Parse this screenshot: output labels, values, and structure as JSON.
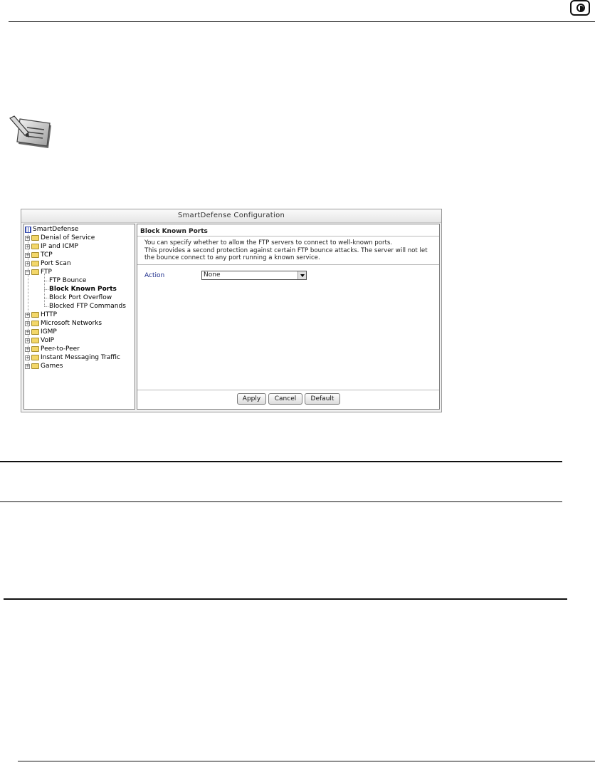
{
  "dialog": {
    "title": "SmartDefense Configuration",
    "tree": {
      "root": "SmartDefense",
      "items": [
        {
          "label": "Denial of Service"
        },
        {
          "label": "IP and ICMP"
        },
        {
          "label": "TCP"
        },
        {
          "label": "Port Scan"
        },
        {
          "label": "FTP"
        },
        {
          "label": "FTP Bounce"
        },
        {
          "label": "Block Known Ports"
        },
        {
          "label": "Block Port Overflow"
        },
        {
          "label": "Blocked FTP Commands"
        },
        {
          "label": "HTTP"
        },
        {
          "label": "Microsoft Networks"
        },
        {
          "label": "IGMP"
        },
        {
          "label": "VoIP"
        },
        {
          "label": "Peer-to-Peer"
        },
        {
          "label": "Instant Messaging Traffic"
        },
        {
          "label": "Games"
        }
      ]
    },
    "panel": {
      "title": "Block Known Ports",
      "description_lines": [
        "You can specify whether to allow the FTP servers to connect to well-known ports.",
        "This provides a second protection against certain FTP bounce attacks. The server will not let",
        "the bounce connect to any port running a known service."
      ],
      "action_label": "Action",
      "action_value": "None"
    },
    "buttons": {
      "apply": "Apply",
      "cancel": "Cancel",
      "default": "Default"
    }
  }
}
